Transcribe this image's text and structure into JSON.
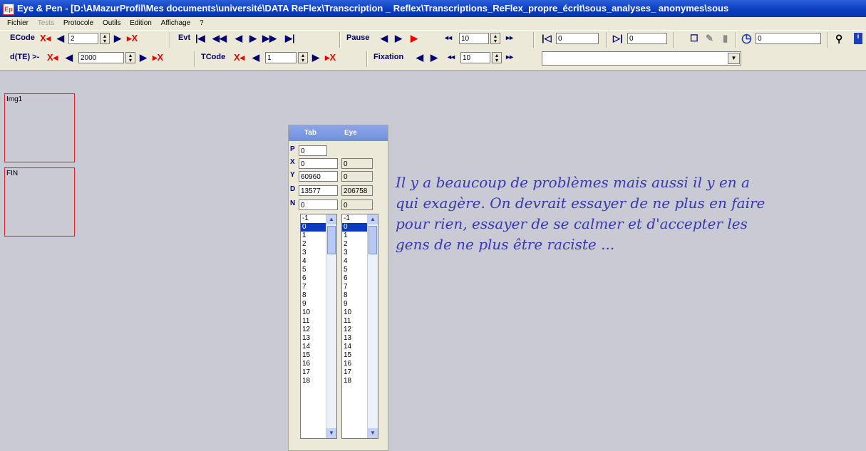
{
  "window": {
    "title": "Eye & Pen - [D:\\AMazurProfil\\Mes documents\\université\\DATA ReFlex\\Transcription _ Reflex\\Transcriptions_ReFlex_propre_écrit\\sous_analyses_ anonymes\\sous",
    "app_icon": "Ep"
  },
  "menu": [
    "Fichier",
    "Tests",
    "Protocole",
    "Outils",
    "Edition",
    "Affichage",
    "?"
  ],
  "toolbar1": {
    "ecode_label": "ECode",
    "ecode_value": "2",
    "evt_label": "Evt",
    "pause_label": "Pause",
    "pause_value": "10",
    "k_value": "0",
    "end_value": "0",
    "clock_value": "0"
  },
  "toolbar2": {
    "dte_label": "d(TE) >-",
    "dte_value": "2000",
    "tcode_label": "TCode",
    "tcode_value": "1",
    "fixation_label": "Fixation",
    "fixation_value": "10",
    "combo_value": ""
  },
  "boxes": {
    "img1": "Img1",
    "fin": "FIN"
  },
  "panel": {
    "col_tab": "Tab",
    "col_eye": "Eye",
    "p": {
      "label": "P",
      "tab": "0"
    },
    "x": {
      "label": "X",
      "tab": "0",
      "eye": "0"
    },
    "y": {
      "label": "Y",
      "tab": "60960",
      "eye": "0"
    },
    "d": {
      "label": "D",
      "tab": "13577",
      "eye": "206758"
    },
    "n": {
      "label": "N",
      "tab": "0",
      "eye": "0"
    },
    "list": [
      "-1",
      "0",
      "1",
      "2",
      "3",
      "4",
      "5",
      "6",
      "7",
      "8",
      "9",
      "10",
      "11",
      "12",
      "13",
      "14",
      "15",
      "16",
      "17",
      "18"
    ],
    "selected": "0"
  },
  "handwriting": [
    "Il y a beaucoup de problèmes mais aussi il y en a",
    "qui exagère. On devrait essayer de ne plus en faire",
    "pour rien, essayer de se calmer et d'accepter les",
    "gens de ne plus être raciste ..."
  ]
}
